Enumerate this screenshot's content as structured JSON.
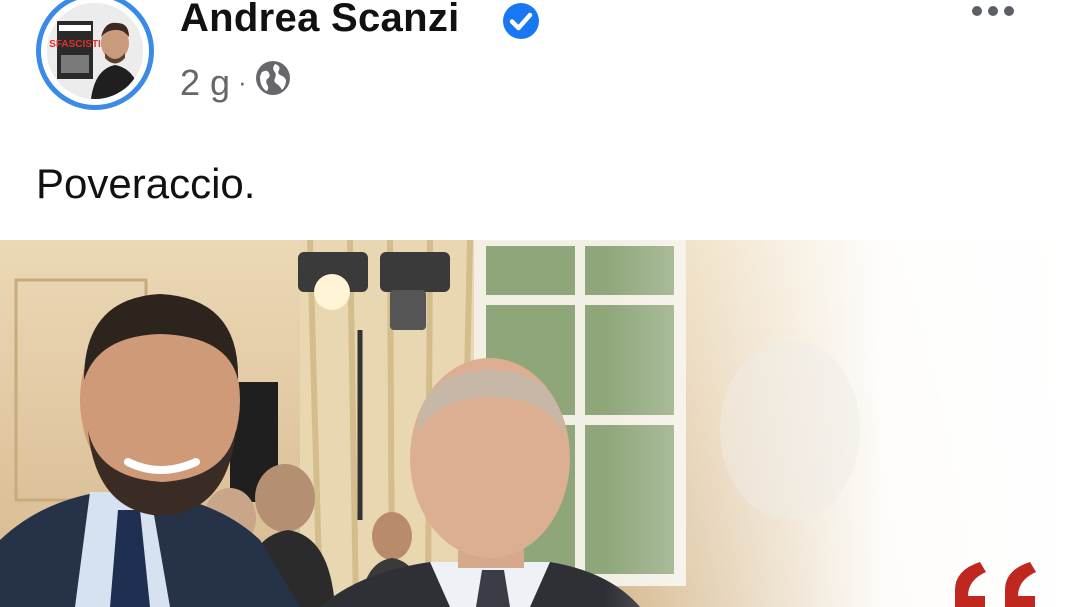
{
  "post": {
    "author_name": "Andrea Scanzi",
    "verified": true,
    "time": "2 g",
    "separator": "·",
    "audience_icon": "globe-icon",
    "text": "Poveraccio."
  },
  "avatar": {
    "book_title": "SFASCISTI"
  },
  "colors": {
    "accent_blue": "#3b8ae6",
    "meta_gray": "#65676b",
    "quote_red": "#c0281f"
  }
}
